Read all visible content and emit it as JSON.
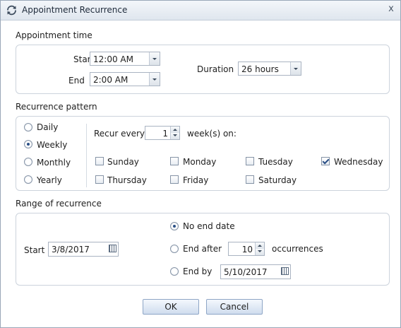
{
  "window": {
    "title": "Appointment Recurrence",
    "title_icon": "recurrence-icon",
    "close_glyph": "x"
  },
  "appointment_time": {
    "section_label": "Appointment time",
    "start_label": "Start",
    "start_value": "12:00 AM",
    "end_label": "End",
    "end_value": "2:00 AM",
    "duration_label": "Duration",
    "duration_value": "26 hours"
  },
  "recurrence_pattern": {
    "section_label": "Recurrence pattern",
    "options": [
      {
        "label": "Daily",
        "selected": false
      },
      {
        "label": "Weekly",
        "selected": true
      },
      {
        "label": "Monthly",
        "selected": false
      },
      {
        "label": "Yearly",
        "selected": false
      }
    ],
    "recur_every_label": "Recur every",
    "recur_every_value": "1",
    "weeks_on_label": "week(s) on:",
    "days": [
      {
        "label": "Sunday",
        "checked": false
      },
      {
        "label": "Monday",
        "checked": false
      },
      {
        "label": "Tuesday",
        "checked": false
      },
      {
        "label": "Wednesday",
        "checked": true
      },
      {
        "label": "Thursday",
        "checked": false
      },
      {
        "label": "Friday",
        "checked": false
      },
      {
        "label": "Saturday",
        "checked": false
      }
    ]
  },
  "range": {
    "section_label": "Range of recurrence",
    "start_label": "Start",
    "start_value": "3/8/2017",
    "no_end_label": "No end date",
    "end_after_label": "End after",
    "end_after_value": "10",
    "occurrences_label": "occurrences",
    "end_by_label": "End by",
    "end_by_value": "5/10/2017",
    "selected": "no_end"
  },
  "buttons": {
    "ok_label": "OK",
    "cancel_label": "Cancel"
  }
}
